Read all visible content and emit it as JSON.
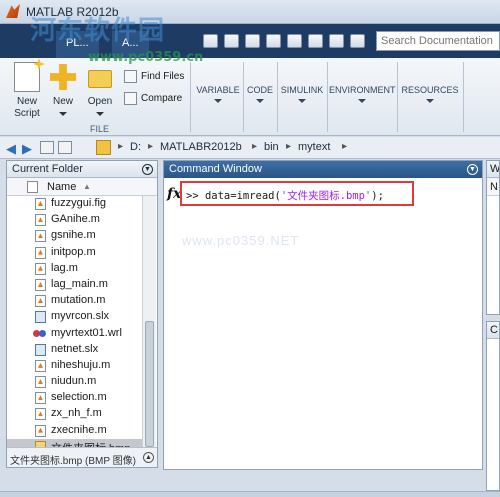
{
  "window": {
    "title": "MATLAB R2012b",
    "watermark": "河东软件园",
    "watermark_url": "www.pc0359.cn"
  },
  "ribbon_tabs": [
    "PL...",
    "A..."
  ],
  "search": {
    "placeholder": "Search Documentation"
  },
  "ribbon": {
    "new_script": "New Script",
    "new": "New",
    "open": "Open",
    "find_files": "Find Files",
    "compare": "Compare",
    "group_label": "FILE",
    "sections": [
      "VARIABLE",
      "CODE",
      "SIMULINK",
      "ENVIRONMENT",
      "RESOURCES"
    ]
  },
  "address": {
    "path": [
      "D:",
      "MATLABR2012b",
      "bin",
      "mytext"
    ]
  },
  "current_folder": {
    "title": "Current Folder",
    "column_name": "Name",
    "column_sort": "▲",
    "files": [
      {
        "name": "fuzzygui.fig",
        "type": "m"
      },
      {
        "name": "GAnihe.m",
        "type": "m"
      },
      {
        "name": "gsnihe.m",
        "type": "m"
      },
      {
        "name": "initpop.m",
        "type": "m"
      },
      {
        "name": "lag.m",
        "type": "m"
      },
      {
        "name": "lag_main.m",
        "type": "m"
      },
      {
        "name": "mutation.m",
        "type": "m"
      },
      {
        "name": "myvrcon.slx",
        "type": "slx"
      },
      {
        "name": "myvrtext01.wrl",
        "type": "wrl"
      },
      {
        "name": "netnet.slx",
        "type": "slx"
      },
      {
        "name": "niheshuju.m",
        "type": "m"
      },
      {
        "name": "niudun.m",
        "type": "m"
      },
      {
        "name": "selection.m",
        "type": "m"
      },
      {
        "name": "zx_nh_f.m",
        "type": "m"
      },
      {
        "name": "zxecnihe.m",
        "type": "m"
      },
      {
        "name": "文件夹图标.bmp",
        "type": "bmp",
        "selected": true
      }
    ],
    "details": "文件夹图标.bmp (BMP 图像)"
  },
  "command_window": {
    "title": "Command Window",
    "prompt": ">> ",
    "code_prefix": "data=imread(",
    "code_string": "'文件夹图标.bmp'",
    "code_suffix": ");",
    "faint_watermark": "www.pc0359.NET",
    "fx": "fx"
  },
  "workspace": {
    "title": "W",
    "column": "N"
  },
  "command_history": {
    "title": "C"
  }
}
